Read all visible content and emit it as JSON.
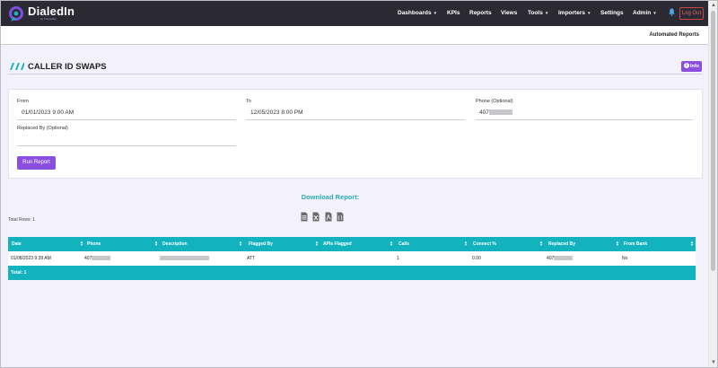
{
  "nav": {
    "brand": "DialedIn",
    "brand_sub": "by Tranquility",
    "items": [
      {
        "label": "Dashboards",
        "caret": true
      },
      {
        "label": "KPIs",
        "caret": false
      },
      {
        "label": "Reports",
        "caret": false
      },
      {
        "label": "Views",
        "caret": false
      },
      {
        "label": "Tools",
        "caret": true
      },
      {
        "label": "Importers",
        "caret": true
      },
      {
        "label": "Settings",
        "caret": false
      },
      {
        "label": "Admin",
        "caret": true
      }
    ],
    "logout_label": "Log Out",
    "caret_glyph": "▾"
  },
  "subheader": {
    "automated_reports": "Automated Reports"
  },
  "page": {
    "title": "CALLER ID SWAPS",
    "info_label": "Info",
    "info_glyph": "i"
  },
  "form": {
    "from_label": "From",
    "from_value": "01/01/2023 9:00 AM",
    "to_label": "To",
    "to_value": "12/05/2023 8:00 PM",
    "phone_label": "Phone (Optional)",
    "phone_value": "407",
    "replaced_by_label": "Replaced By (Optional)",
    "replaced_by_value": "",
    "run_label": "Run Report"
  },
  "download": {
    "title": "Download Report:",
    "total_rows": "Total Rows: 1",
    "formats": [
      "csv-icon",
      "excel-icon",
      "pdf-icon",
      "json-icon"
    ]
  },
  "table": {
    "columns": [
      "Date",
      "Phone",
      "Description",
      "Flagged By",
      "APIs Flagged",
      "Calls",
      "Connect %",
      "Replaced By",
      "From Bank"
    ],
    "rows": [
      {
        "date": "01/08/2023 9:39 AM",
        "phone": "407",
        "description": "",
        "flagged_by": "ATT",
        "apis_flagged": "",
        "calls": "1",
        "connect": "0.00",
        "replaced_by": "407",
        "from_bank": "No"
      }
    ],
    "footer": "Total: 1"
  },
  "colors": {
    "nav_bg": "#2b2a33",
    "accent_purple": "#8a4fe0",
    "teal": "#12b3bf",
    "download_teal": "#2aa9b4",
    "logout_red": "#c84747",
    "page_bg": "#f3f1fb"
  }
}
